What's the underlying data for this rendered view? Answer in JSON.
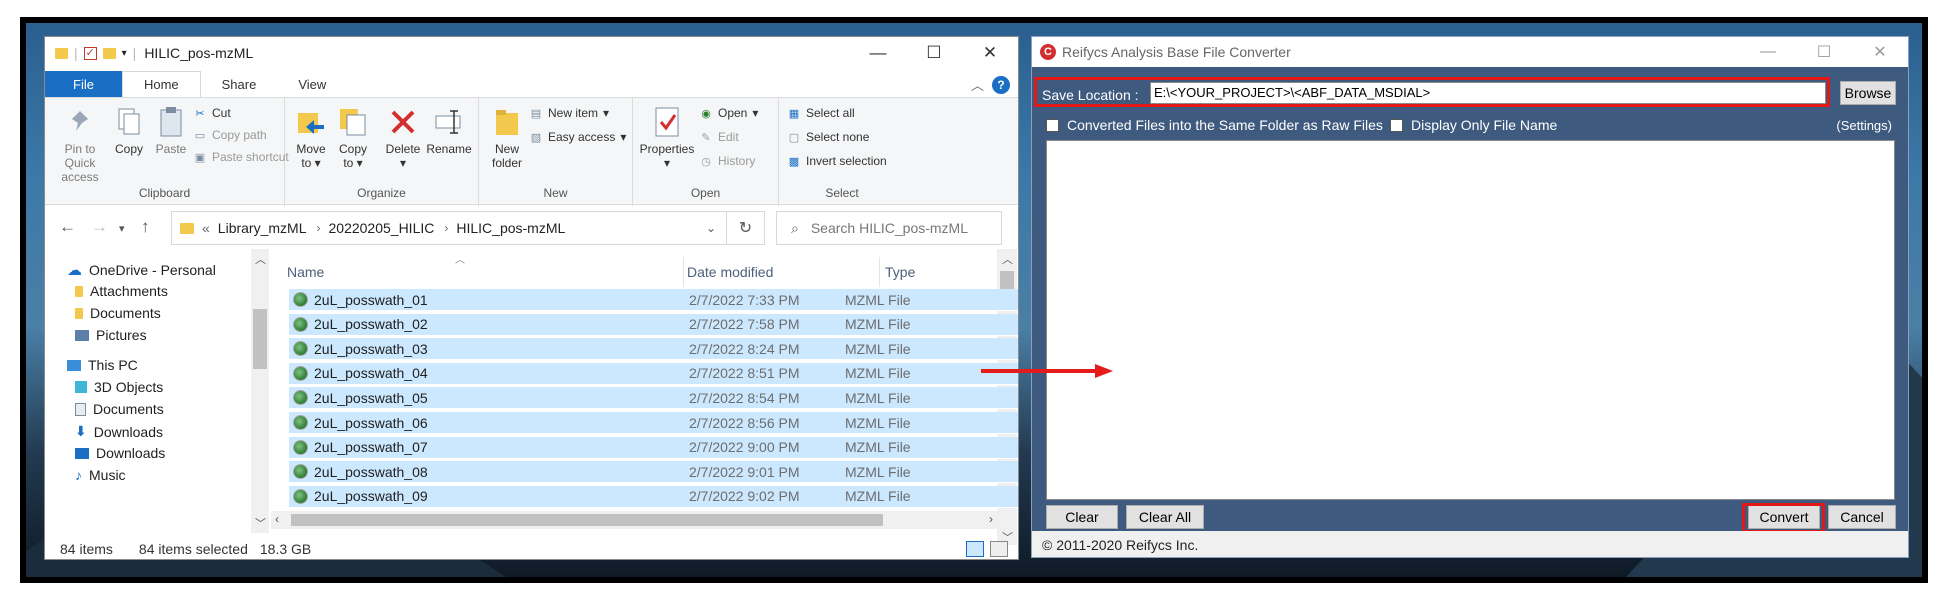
{
  "explorer": {
    "title": "HILIC_pos-mzML",
    "window_controls": {
      "minimize": "—",
      "maximize": "☐",
      "close": "✕"
    },
    "tabs": [
      "File",
      "Home",
      "Share",
      "View"
    ],
    "ribbon": {
      "clipboard": {
        "label": "Clipboard",
        "pin": "Pin to Quick access",
        "copy": "Copy",
        "paste": "Paste",
        "cut": "Cut",
        "copy_path": "Copy path",
        "paste_shortcut": "Paste shortcut"
      },
      "organize": {
        "label": "Organize",
        "move_to": "Move to",
        "copy_to": "Copy to",
        "delete": "Delete",
        "rename": "Rename"
      },
      "new": {
        "label": "New",
        "new_folder": "New folder",
        "new_item": "New item",
        "easy_access": "Easy access"
      },
      "open": {
        "label": "Open",
        "properties": "Properties",
        "open": "Open",
        "edit": "Edit",
        "history": "History"
      },
      "select": {
        "label": "Select",
        "select_all": "Select all",
        "select_none": "Select none",
        "invert_selection": "Invert selection"
      }
    },
    "address": {
      "prefix": "«",
      "crumbs": [
        "Library_mzML",
        "20220205_HILIC",
        "HILIC_pos-mzML"
      ],
      "search_placeholder": "Search HILIC_pos-mzML"
    },
    "nav": [
      "OneDrive - Personal",
      "Attachments",
      "Documents",
      "Pictures",
      "This PC",
      "3D Objects",
      "Documents",
      "Downloads",
      "Downloads",
      "Music"
    ],
    "columns": {
      "name": "Name",
      "date": "Date modified",
      "type": "Type"
    },
    "files": [
      {
        "name": "2uL_posswath_01",
        "date": "2/7/2022 7:33 PM",
        "type": "MZML File"
      },
      {
        "name": "2uL_posswath_02",
        "date": "2/7/2022 7:58 PM",
        "type": "MZML File"
      },
      {
        "name": "2uL_posswath_03",
        "date": "2/7/2022 8:24 PM",
        "type": "MZML File"
      },
      {
        "name": "2uL_posswath_04",
        "date": "2/7/2022 8:51 PM",
        "type": "MZML File"
      },
      {
        "name": "2uL_posswath_05",
        "date": "2/7/2022 8:54 PM",
        "type": "MZML File"
      },
      {
        "name": "2uL_posswath_06",
        "date": "2/7/2022 8:56 PM",
        "type": "MZML File"
      },
      {
        "name": "2uL_posswath_07",
        "date": "2/7/2022 9:00 PM",
        "type": "MZML File"
      },
      {
        "name": "2uL_posswath_08",
        "date": "2/7/2022 9:01 PM",
        "type": "MZML File"
      },
      {
        "name": "2uL_posswath_09",
        "date": "2/7/2022 9:02 PM",
        "type": "MZML File"
      }
    ],
    "status": {
      "count": "84 items",
      "selected": "84 items selected",
      "size": "18.3 GB"
    }
  },
  "converter": {
    "title": "Reifycs Analysis Base File Converter",
    "save_location_label": "Save Location :",
    "save_location_value": "E:\\<YOUR_PROJECT>\\<ABF_DATA_MSDIAL>",
    "browse": "Browse",
    "same_folder": "Converted Files into the Same Folder as Raw Files",
    "display_only_name": "Display Only File Name",
    "settings": "(Settings)",
    "clear": "Clear",
    "clear_all": "Clear All",
    "convert": "Convert",
    "cancel": "Cancel",
    "copyright": "© 2011-2020 Reifycs Inc."
  },
  "colors": {
    "highlight": "#e01818",
    "selection": "#cce8ff",
    "converter_bg": "#3f5a7f",
    "file_tab": "#1a6fc4"
  }
}
